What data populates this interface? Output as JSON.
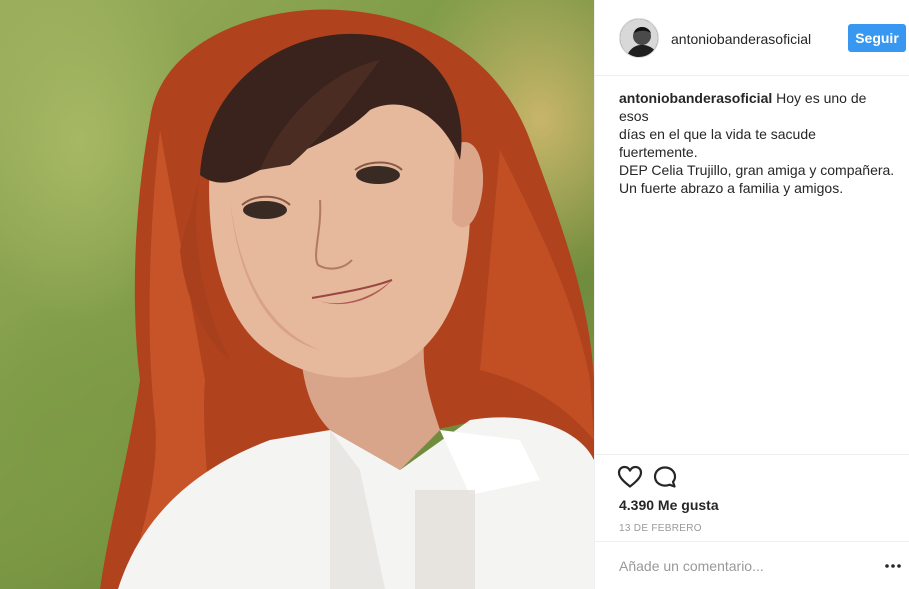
{
  "post": {
    "photo_icon": "portrait-photo",
    "author": {
      "username": "antoniobanderasoficial",
      "avatar_icon": "profile-avatar"
    },
    "follow_label": "Seguir",
    "caption": {
      "username": "antoniobanderasoficial",
      "lines": [
        "Hoy es uno de esos",
        "días en el que la vida te sacude",
        "fuertemente.",
        "DEP Celia Trujillo, gran amiga y compañera.",
        "Un fuerte abrazo a familia y amigos."
      ]
    },
    "actions": {
      "like_icon": "heart-icon",
      "comment_icon": "comment-bubble-icon"
    },
    "likes_text": "4.390 Me gusta",
    "date_text": "13 DE FEBRERO",
    "comment_placeholder": "Añade un comentario...",
    "more_icon": "more-options-icon"
  },
  "colors": {
    "accent": "#3897f0",
    "text": "#262626",
    "muted": "#999999",
    "border": "#efefef"
  }
}
